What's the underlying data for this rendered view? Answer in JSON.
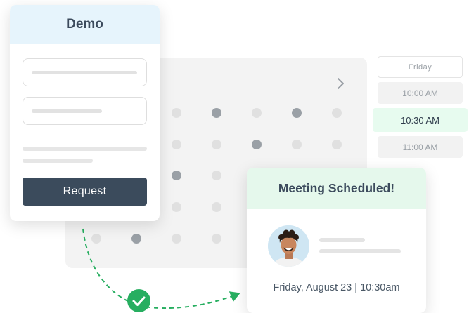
{
  "demo_form": {
    "title": "Demo",
    "submit_label": "Request"
  },
  "time_picker": {
    "day": "Friday",
    "slots": [
      "10:00 AM",
      "10:30 AM",
      "11:00 AM"
    ],
    "selected": "10:30 AM"
  },
  "confirmation": {
    "title": "Meeting Scheduled!",
    "datetime": "Friday, August 23 | 10:30am"
  },
  "colors": {
    "accent_green": "#27ae60",
    "button_dark": "#3b4b5c",
    "demo_header": "#e6f4fc",
    "confirm_header": "#e5f8ec"
  }
}
